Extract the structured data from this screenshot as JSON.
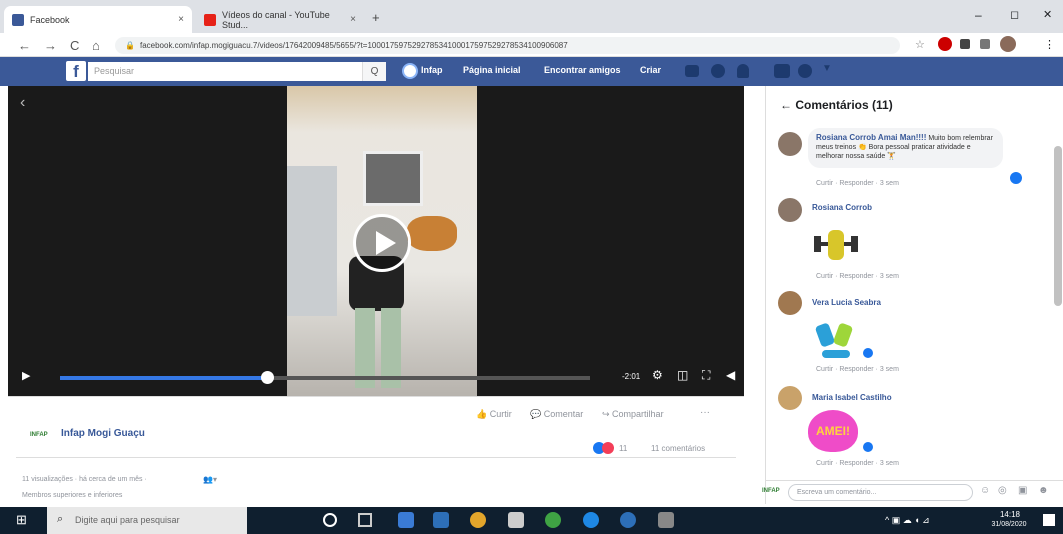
{
  "browser": {
    "tabs": [
      {
        "title": "Facebook",
        "close": "×",
        "favicon_color": "#3b5998"
      },
      {
        "title": "Vídeos do canal - YouTube Stud...",
        "close": "×",
        "favicon_color": "#e62117"
      }
    ],
    "new_tab": "+",
    "window_controls": {
      "min": "–",
      "max": "◻",
      "close": "✕"
    },
    "nav": {
      "back": "←",
      "forward": "→",
      "reload": "C",
      "home": "⌂"
    },
    "url": "facebook.com/infap.mogiguacu.7/videos/17642009485/5655/?t=100017597529278534100017597529278534100906087"
  },
  "facebook": {
    "logo": "f",
    "search_placeholder": "Pesquisar",
    "search_icon": "Q",
    "nav": {
      "profile": "Infap",
      "home": "Página inicial",
      "find_friends": "Encontrar amigos",
      "create": "Criar"
    },
    "icons": [
      "people-icon",
      "messenger-icon",
      "bell-icon",
      "help-icon",
      "dropdown-icon"
    ]
  },
  "video": {
    "time": "-2:01",
    "progress": 0.39,
    "controls": {
      "play": "▶",
      "settings": "⚙",
      "pip": "◫",
      "fullscreen": "⛶",
      "volume": "◀"
    }
  },
  "post": {
    "actions": {
      "like": "Curtir",
      "comment": "Comentar",
      "share": "Compartilhar",
      "more": "···"
    },
    "page_badge": "INFAP",
    "page_name": "Infap Mogi Guaçu",
    "reactions_count": "11",
    "comments_count": "11 comentários",
    "meta": "11 visualizações · há cerca de um mês ·",
    "audience": "Membros superiores e inferiores"
  },
  "comments_panel": {
    "title": "← Comentários (11)",
    "comments": [
      {
        "name": "Rosiana Corrob Amai Man!!!!",
        "text": "Muito bom relembrar meus treinos 👏 Bora pessoal praticar atividade e melhorar nossa saúde 🏋",
        "like": "Curtir",
        "reply": "Responder",
        "time": "3 sem"
      },
      {
        "name": "Rosiana Corrob",
        "text": "",
        "like": "Curtir",
        "reply": "Responder",
        "time": "3 sem"
      },
      {
        "name": "Vera Lucia Seabra",
        "text": "",
        "like": "Curtir",
        "reply": "Responder",
        "time": "3 sem"
      },
      {
        "name": "Maria Isabel Castilho",
        "text": "",
        "like": "Curtir",
        "reply": "Responder",
        "time": "3 sem"
      }
    ],
    "sticker_amei": "AMEI!",
    "write_placeholder": "Escreva um comentário...",
    "author_badge": "INFAP"
  },
  "taskbar": {
    "start": "⊞",
    "search_placeholder": "Digite aqui para pesquisar",
    "clock_time": "14:18",
    "clock_date": "31/08/2020"
  }
}
